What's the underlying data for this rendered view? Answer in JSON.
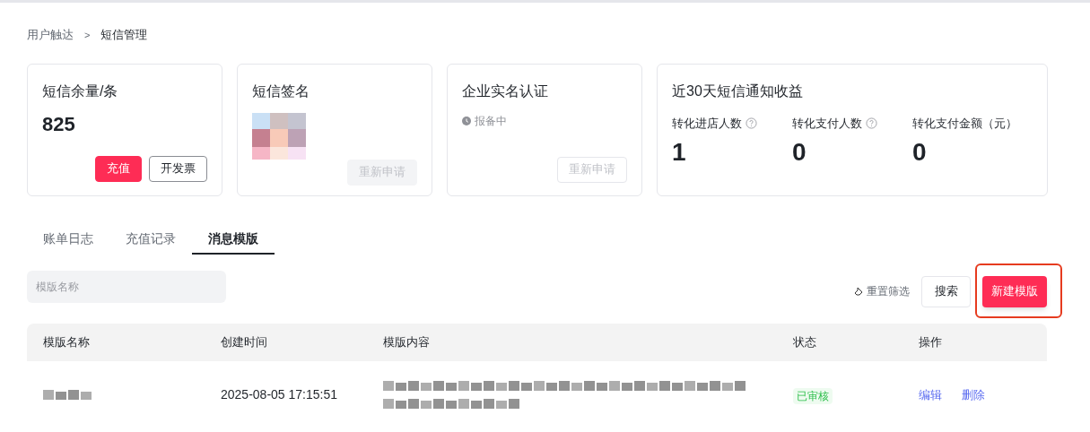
{
  "breadcrumb": [
    {
      "label": "用户触达",
      "current": false
    },
    {
      "label": ">",
      "kind": "separator"
    },
    {
      "label": "短信管理",
      "current": true
    }
  ],
  "cards": [
    {
      "kind": "balance",
      "title": "短信余量/条",
      "value": "825",
      "buttons": [
        {
          "label": "充值",
          "primary": true,
          "disabled": false
        },
        {
          "label": "开发票",
          "primary": false,
          "disabled": false
        }
      ]
    },
    {
      "kind": "signature",
      "title": "短信签名",
      "buttons": [
        {
          "label": "重新申请",
          "disabled": true,
          "filled": true
        }
      ]
    },
    {
      "kind": "certification",
      "title": "企业实名认证",
      "status": "报备中",
      "buttons": [
        {
          "label": "重新申请",
          "disabled": true,
          "filled": false
        }
      ]
    },
    {
      "kind": "stats",
      "title": "近30天短信通知收益",
      "stats": [
        {
          "label": "转化进店人数",
          "help": true,
          "value": "1"
        },
        {
          "label": "转化支付人数",
          "help": true,
          "value": "0"
        },
        {
          "label": "转化支付金额（元）",
          "help": false,
          "value": "0"
        }
      ]
    }
  ],
  "tabs": [
    {
      "label": "账单日志",
      "selected": false
    },
    {
      "label": "充值记录",
      "selected": false
    },
    {
      "label": "消息模版",
      "selected": true
    }
  ],
  "filter": {
    "placeholder": "模版名称",
    "reset": "重置筛选",
    "search": "搜索",
    "create": {
      "label": "新建模版",
      "highlighted": true
    }
  },
  "table": {
    "columns": [
      "模版名称",
      "创建时间",
      "模版内容",
      "状态",
      "操作"
    ],
    "rows": [
      {
        "created": "2025-08-05 17:15:51",
        "status": "已审核",
        "approved": true,
        "actions": [
          "编辑",
          "删除"
        ]
      }
    ]
  }
}
